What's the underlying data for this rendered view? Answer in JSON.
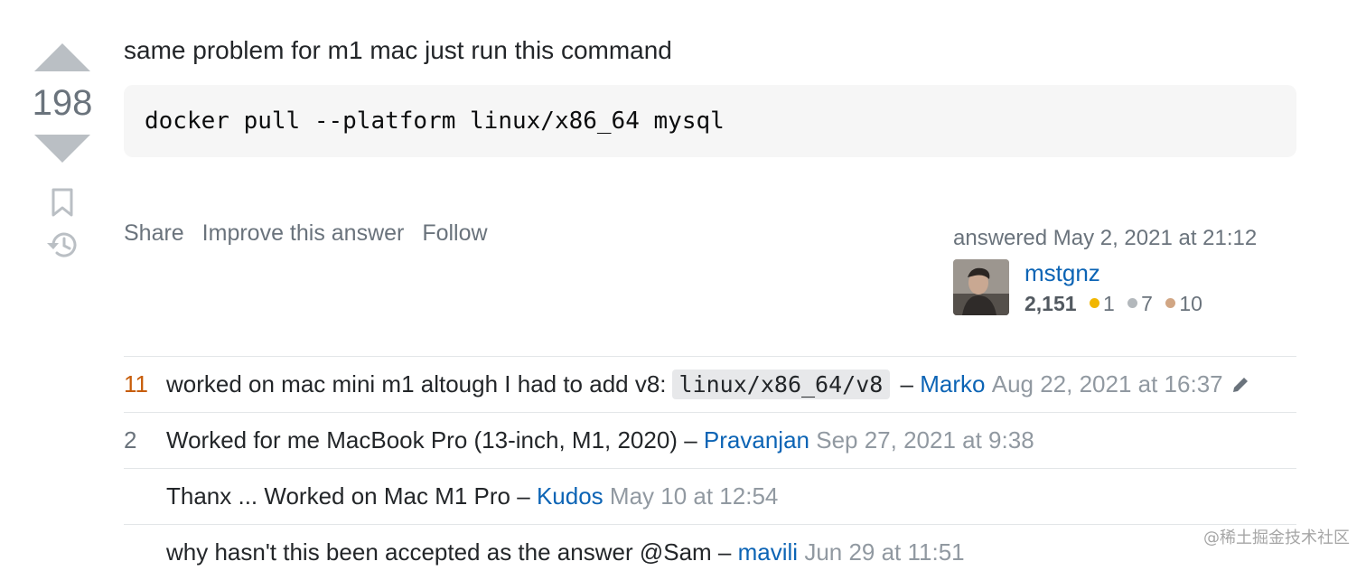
{
  "vote": {
    "count": "198"
  },
  "post": {
    "text": "same problem for m1 mac just run this command",
    "code": "docker pull --platform linux/x86_64 mysql"
  },
  "menu": {
    "share": "Share",
    "improve": "Improve this answer",
    "follow": "Follow"
  },
  "user": {
    "action": "answered May 2, 2021 at 21:12",
    "name": "mstgnz",
    "reputation": "2,151",
    "badges": {
      "gold": "1",
      "silver": "7",
      "bronze": "10"
    },
    "badge_colors": {
      "gold": "#f1b600",
      "silver": "#b3b8bc",
      "bronze": "#d1a684"
    }
  },
  "comments": [
    {
      "score": "11",
      "text": "worked on mac mini m1 altough I had to add v8:",
      "code": "linux/x86_64/v8",
      "sep": "–",
      "user": "Marko",
      "date": "Aug 22, 2021 at 16:37",
      "edited": true
    },
    {
      "score": "2",
      "text": "Worked for me MacBook Pro (13-inch, M1, 2020)",
      "sep": "–",
      "user": "Pravanjan",
      "date": "Sep 27, 2021 at 9:38"
    },
    {
      "score": "",
      "text": "Thanx ... Worked on Mac M1 Pro",
      "sep": "–",
      "user": "Kudos",
      "date": "May 10 at 12:54"
    },
    {
      "score": "",
      "text": "why hasn't this been accepted as the answer @Sam",
      "sep": "–",
      "user": "mavili",
      "date": "Jun 29 at 11:51"
    }
  ],
  "watermark": "@稀土掘金技术社区",
  "icons": {
    "vote_up": "triangle-up-icon",
    "vote_down": "triangle-down-icon",
    "bookmark": "bookmark-icon",
    "history": "history-icon",
    "edit": "pencil-icon"
  }
}
